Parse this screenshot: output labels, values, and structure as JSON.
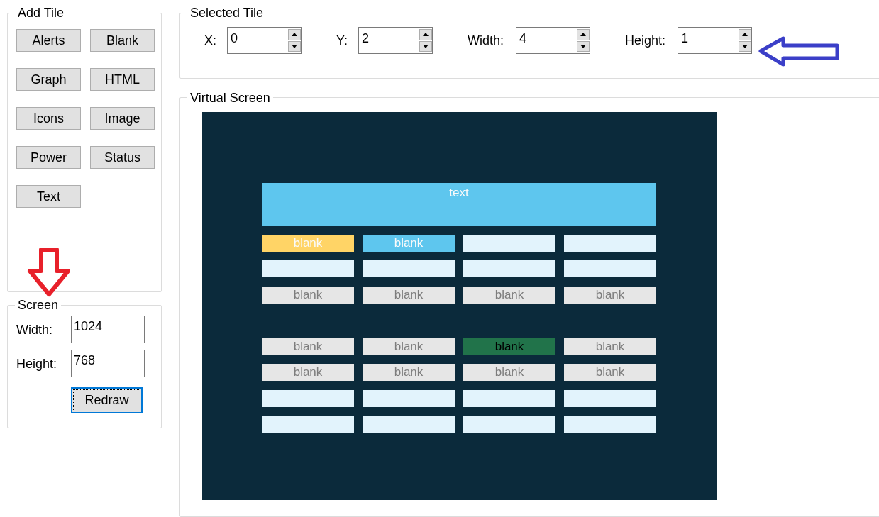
{
  "add_tile": {
    "title": "Add Tile",
    "buttons": [
      "Alerts",
      "Blank",
      "Graph",
      "HTML",
      "Icons",
      "Image",
      "Power",
      "Status",
      "Text"
    ]
  },
  "screen": {
    "title": "Screen",
    "fields": [
      {
        "label": "Width:",
        "value": "1024"
      },
      {
        "label": "Height:",
        "value": "768"
      }
    ],
    "redraw_button": {
      "label": "Redraw",
      "focused": true
    }
  },
  "selected_tile": {
    "title": "Selected Tile",
    "fields": [
      {
        "label": "X:",
        "value": "0"
      },
      {
        "label": "Y:",
        "value": "2"
      },
      {
        "label": "Width:",
        "value": "4"
      },
      {
        "label": "Height:",
        "value": "1"
      }
    ]
  },
  "virtual_screen": {
    "title": "Virtual Screen",
    "rows": [
      {
        "kind": "tall",
        "tiles": [
          {
            "label": "text",
            "color": "#5ec6ee",
            "dark_label": false
          }
        ]
      },
      {
        "kind": "normal",
        "tiles": [
          {
            "label": "blank",
            "color": "#ffd466",
            "dark_label": false
          },
          {
            "label": "blank",
            "color": "#5ec6ee",
            "dark_label": false
          },
          {
            "color": "#e2f3fc"
          },
          {
            "color": "#e2f3fc"
          }
        ]
      },
      {
        "kind": "normal",
        "tiles": [
          {
            "color": "#e2f3fc"
          },
          {
            "color": "#e2f3fc"
          },
          {
            "color": "#e2f3fc"
          },
          {
            "color": "#e2f3fc"
          }
        ]
      },
      {
        "kind": "normal",
        "tiles": [
          {
            "label": "blank",
            "color": "#e6e6e6",
            "dark_label": false,
            "faded": true
          },
          {
            "label": "blank",
            "color": "#e6e6e6",
            "dark_label": false,
            "faded": true
          },
          {
            "label": "blank",
            "color": "#e6e6e6",
            "dark_label": false,
            "faded": true
          },
          {
            "label": "blank",
            "color": "#e6e6e6",
            "dark_label": false,
            "faded": true
          }
        ]
      },
      {
        "kind": "gap"
      },
      {
        "kind": "normal",
        "tiles": [
          {
            "label": "blank",
            "color": "#e6e6e6",
            "dark_label": false,
            "faded": true
          },
          {
            "label": "blank",
            "color": "#e6e6e6",
            "dark_label": false,
            "faded": true
          },
          {
            "label": "blank",
            "color": "#21734a",
            "dark_label": true,
            "faded": false
          },
          {
            "label": "blank",
            "color": "#e6e6e6",
            "dark_label": false,
            "faded": true
          }
        ]
      },
      {
        "kind": "normal",
        "tiles": [
          {
            "label": "blank",
            "color": "#e6e6e6",
            "dark_label": false,
            "faded": true
          },
          {
            "label": "blank",
            "color": "#e6e6e6",
            "dark_label": false,
            "faded": true
          },
          {
            "label": "blank",
            "color": "#e6e6e6",
            "dark_label": false,
            "faded": true
          },
          {
            "label": "blank",
            "color": "#e6e6e6",
            "dark_label": false,
            "faded": true
          }
        ]
      },
      {
        "kind": "normal",
        "tiles": [
          {
            "color": "#e2f3fc"
          },
          {
            "color": "#e2f3fc"
          },
          {
            "color": "#e2f3fc"
          },
          {
            "color": "#e2f3fc"
          }
        ]
      },
      {
        "kind": "normal",
        "tiles": [
          {
            "color": "#e2f3fc"
          },
          {
            "color": "#e2f3fc"
          },
          {
            "color": "#e2f3fc"
          },
          {
            "color": "#e2f3fc"
          }
        ]
      }
    ]
  }
}
